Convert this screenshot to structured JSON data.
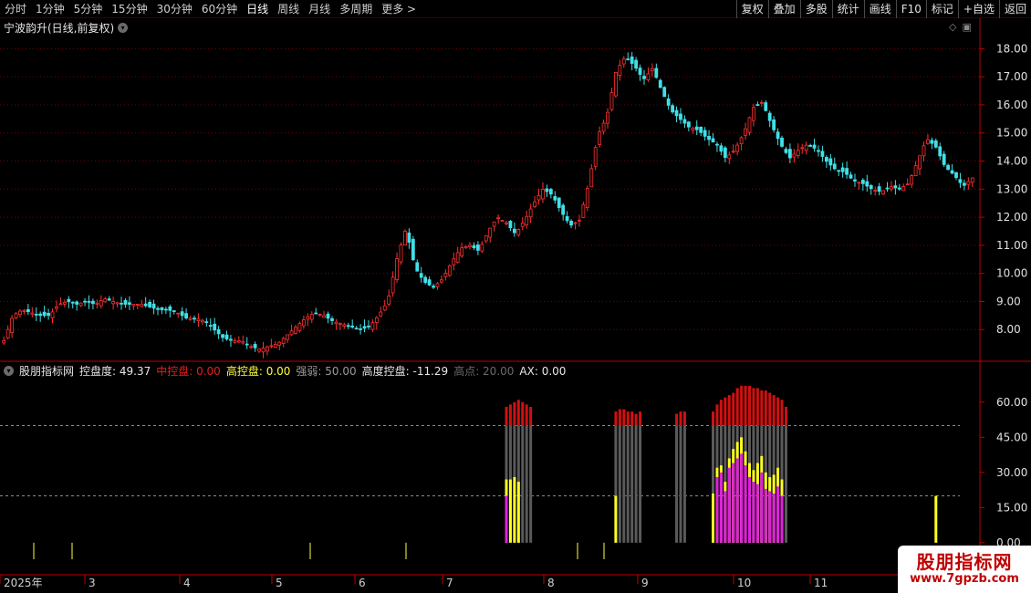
{
  "toolbar": {
    "periods": [
      "分时",
      "1分钟",
      "5分钟",
      "15分钟",
      "30分钟",
      "60分钟",
      "日线",
      "周线",
      "月线",
      "多周期",
      "更多 >"
    ],
    "active_period": "日线",
    "buttons": [
      "复权",
      "叠加",
      "多股",
      "统计",
      "画线",
      "F10",
      "标记",
      "+自选",
      "返回"
    ]
  },
  "price_panel": {
    "title": "宁波韵升(日线,前复权)",
    "y_ticks": [
      "18.00",
      "17.00",
      "16.00",
      "15.00",
      "14.00",
      "13.00",
      "12.00",
      "11.00",
      "10.00",
      "9.00",
      "8.00"
    ]
  },
  "indicator_panel": {
    "name": "股朋指标网",
    "items": [
      {
        "label": "控盘度:",
        "value": "49.37",
        "color": "#e6e6e6"
      },
      {
        "label": "中控盘:",
        "value": "0.00",
        "color": "#e02020"
      },
      {
        "label": "高控盘:",
        "value": "0.00",
        "color": "#ffff40"
      },
      {
        "label": "强弱:",
        "value": "50.00",
        "color": "#9a9a9a"
      },
      {
        "label": "高度控盘:",
        "value": "-11.29",
        "color": "#e6e6e6"
      },
      {
        "label": "高点:",
        "value": "20.00",
        "color": "#6a6a6a"
      },
      {
        "label": "AX:",
        "value": "0.00",
        "color": "#e6e6e6"
      }
    ],
    "y_ticks": [
      "60.00",
      "45.00",
      "30.00",
      "15.00",
      "0.00"
    ]
  },
  "x_axis": {
    "labels": [
      "2025年",
      "3",
      "4",
      "5",
      "6",
      "7",
      "8",
      "9",
      "10",
      "11"
    ]
  },
  "colors": {
    "up": "#ff3030",
    "down": "#40e0e8",
    "grid": "#7a0000",
    "axis": "#c00000",
    "bar_red": "#d01010",
    "bar_gray": "#5a5a5a",
    "bar_yellow": "#ffff20",
    "bar_magenta": "#e020e0"
  },
  "watermark": {
    "main": "股朋指标网",
    "sub": "www.7gpzb.com"
  },
  "chart_data": [
    {
      "type": "candlestick",
      "title": "宁波韵升(日线,前复权)",
      "ylim": [
        7.0,
        18.5
      ],
      "x": [
        "2025年",
        "3",
        "4",
        "5",
        "6",
        "7",
        "8",
        "9",
        "10",
        "11"
      ],
      "series": [
        {
          "close": [
            7.6,
            8.5,
            8.7,
            8.6,
            8.5,
            8.5,
            8.9,
            9.0,
            8.9,
            9.0,
            8.9,
            9.1,
            9.0,
            8.9,
            8.9,
            8.9,
            8.8,
            8.7,
            8.7,
            8.6,
            8.4,
            8.4,
            8.3,
            8.0,
            7.7,
            7.6,
            7.6,
            7.4,
            7.3,
            7.4,
            7.5,
            7.8,
            8.1,
            8.4,
            8.6,
            8.5,
            8.3,
            8.2,
            8.1,
            8.0,
            8.1,
            8.5,
            9.0,
            10.5,
            11.6,
            10.2,
            9.7,
            9.5,
            9.8,
            10.4,
            10.9,
            11.0,
            10.8,
            11.5,
            12.0,
            11.8,
            11.4,
            11.9,
            12.5,
            13.0,
            12.8,
            12.2,
            11.7,
            11.9,
            13.2,
            14.9,
            15.6,
            17.2,
            17.7,
            17.4,
            16.9,
            17.3,
            16.5,
            15.8,
            15.5,
            15.2,
            15.1,
            14.8,
            14.6,
            14.1,
            14.4,
            15.0,
            15.9,
            16.1,
            15.3,
            14.6,
            14.1,
            14.4,
            14.6,
            14.4,
            14.0,
            13.7,
            13.6,
            13.3,
            13.2,
            13.0,
            12.9,
            13.1,
            13.0,
            13.2,
            14.0,
            14.8,
            14.5,
            13.8,
            13.5,
            13.1,
            13.4
          ]
        }
      ]
    },
    {
      "type": "bar",
      "title": "股朋指标网",
      "ylim": [
        -2,
        72
      ],
      "dashed_lines": [
        50,
        20
      ],
      "stacked_columns": [
        {
          "x_day": 124,
          "magenta": 20,
          "yellow": 27,
          "gray_top": 50,
          "red_top": 58
        },
        {
          "x_day": 125,
          "magenta": 0,
          "yellow": 27,
          "gray_top": 50,
          "red_top": 59
        },
        {
          "x_day": 126,
          "magenta": 0,
          "yellow": 28,
          "gray_top": 50,
          "red_top": 60
        },
        {
          "x_day": 127,
          "magenta": 0,
          "yellow": 26,
          "gray_top": 50,
          "red_top": 61
        },
        {
          "x_day": 128,
          "magenta": 0,
          "yellow": 0,
          "gray_top": 50,
          "red_top": 60
        },
        {
          "x_day": 129,
          "magenta": 0,
          "yellow": 0,
          "gray_top": 50,
          "red_top": 59
        },
        {
          "x_day": 130,
          "magenta": 0,
          "yellow": 0,
          "gray_top": 50,
          "red_top": 58
        },
        {
          "x_day": 151,
          "magenta": 0,
          "yellow": 20,
          "gray_top": 50,
          "red_top": 56
        },
        {
          "x_day": 152,
          "magenta": 0,
          "yellow": 0,
          "gray_top": 50,
          "red_top": 57
        },
        {
          "x_day": 153,
          "magenta": 0,
          "yellow": 0,
          "gray_top": 50,
          "red_top": 57
        },
        {
          "x_day": 154,
          "magenta": 0,
          "yellow": 0,
          "gray_top": 50,
          "red_top": 56
        },
        {
          "x_day": 155,
          "magenta": 0,
          "yellow": 0,
          "gray_top": 50,
          "red_top": 56
        },
        {
          "x_day": 156,
          "magenta": 0,
          "yellow": 0,
          "gray_top": 50,
          "red_top": 55
        },
        {
          "x_day": 157,
          "magenta": 0,
          "yellow": 0,
          "gray_top": 50,
          "red_top": 56
        },
        {
          "x_day": 166,
          "magenta": 0,
          "yellow": 0,
          "gray_top": 50,
          "red_top": 55
        },
        {
          "x_day": 167,
          "magenta": 0,
          "yellow": 0,
          "gray_top": 50,
          "red_top": 56
        },
        {
          "x_day": 168,
          "magenta": 0,
          "yellow": 0,
          "gray_top": 50,
          "red_top": 56
        },
        {
          "x_day": 175,
          "magenta": 0,
          "yellow": 21,
          "gray_top": 50,
          "red_top": 56
        },
        {
          "x_day": 176,
          "magenta": 28,
          "yellow": 32,
          "gray_top": 50,
          "red_top": 59
        },
        {
          "x_day": 177,
          "magenta": 30,
          "yellow": 33,
          "gray_top": 50,
          "red_top": 61
        },
        {
          "x_day": 178,
          "magenta": 22,
          "yellow": 26,
          "gray_top": 50,
          "red_top": 62
        },
        {
          "x_day": 179,
          "magenta": 32,
          "yellow": 36,
          "gray_top": 50,
          "red_top": 63
        },
        {
          "x_day": 180,
          "magenta": 34,
          "yellow": 40,
          "gray_top": 50,
          "red_top": 64
        },
        {
          "x_day": 181,
          "magenta": 36,
          "yellow": 43,
          "gray_top": 50,
          "red_top": 66
        },
        {
          "x_day": 182,
          "magenta": 38,
          "yellow": 45,
          "gray_top": 50,
          "red_top": 67
        },
        {
          "x_day": 183,
          "magenta": 33,
          "yellow": 39,
          "gray_top": 50,
          "red_top": 67
        },
        {
          "x_day": 184,
          "magenta": 28,
          "yellow": 34,
          "gray_top": 50,
          "red_top": 67
        },
        {
          "x_day": 185,
          "magenta": 26,
          "yellow": 31,
          "gray_top": 50,
          "red_top": 66
        },
        {
          "x_day": 186,
          "magenta": 25,
          "yellow": 34,
          "gray_top": 50,
          "red_top": 66
        },
        {
          "x_day": 187,
          "magenta": 30,
          "yellow": 37,
          "gray_top": 50,
          "red_top": 65
        },
        {
          "x_day": 188,
          "magenta": 23,
          "yellow": 30,
          "gray_top": 50,
          "red_top": 65
        },
        {
          "x_day": 189,
          "magenta": 22,
          "yellow": 28,
          "gray_top": 50,
          "red_top": 64
        },
        {
          "x_day": 190,
          "magenta": 21,
          "yellow": 29,
          "gray_top": 50,
          "red_top": 63
        },
        {
          "x_day": 191,
          "magenta": 24,
          "yellow": 32,
          "gray_top": 50,
          "red_top": 62
        },
        {
          "x_day": 192,
          "magenta": 20,
          "yellow": 27,
          "gray_top": 50,
          "red_top": 61
        },
        {
          "x_day": 193,
          "magenta": 0,
          "yellow": 0,
          "gray_top": 50,
          "red_top": 58
        }
      ],
      "standalone_yellow": [
        {
          "x_day": 230,
          "value": 20
        }
      ]
    }
  ]
}
